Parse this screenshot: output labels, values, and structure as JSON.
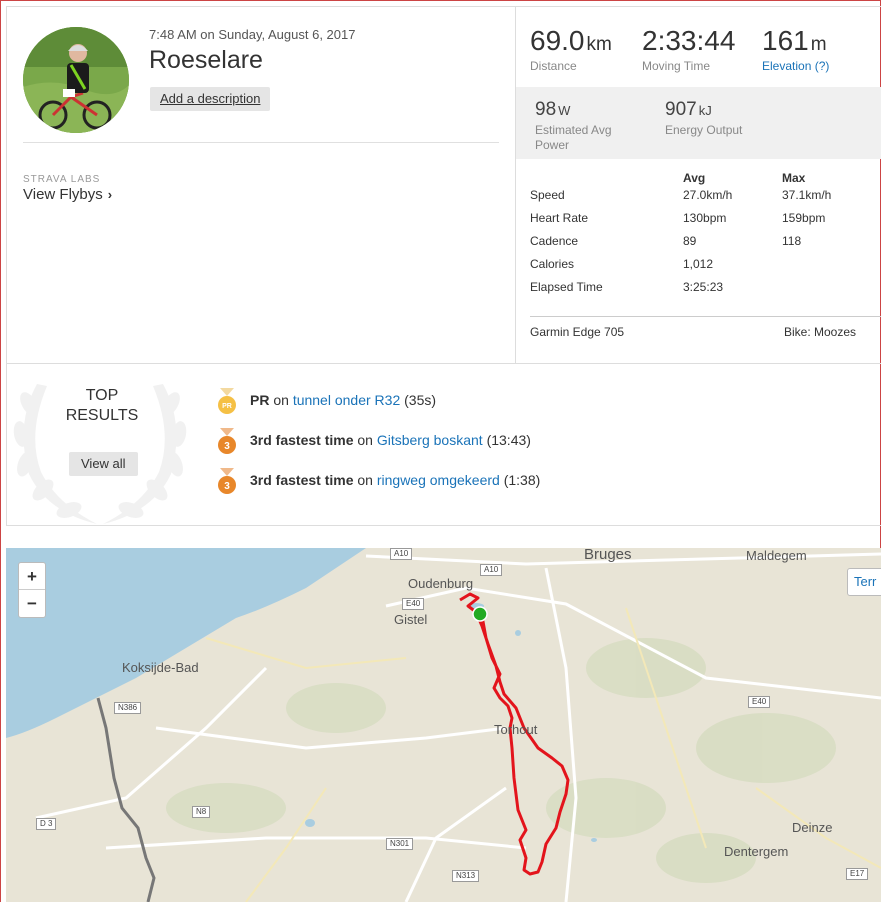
{
  "activity": {
    "timestamp": "7:48 AM on Sunday, August 6, 2017",
    "name": "Roeselare",
    "add_description": "Add a description",
    "labs_label": "STRAVA LABS",
    "flybys_link": "View Flybys",
    "chevron": "›"
  },
  "primary_stats": [
    {
      "value": "69.0",
      "unit": "km",
      "label": "Distance"
    },
    {
      "value": "2:33:44",
      "unit": "",
      "label": "Moving Time"
    },
    {
      "value": "161",
      "unit": "m",
      "label": "Elevation (?)"
    }
  ],
  "secondary_stats": [
    {
      "value": "98",
      "unit": "W",
      "label_line1": "Estimated Avg",
      "label_line2": "Power"
    },
    {
      "value": "907",
      "unit": "kJ",
      "label_line1": "Energy Output",
      "label_line2": ""
    }
  ],
  "more_stats": {
    "headers": {
      "avg": "Avg",
      "max": "Max"
    },
    "rows": [
      {
        "label": "Speed",
        "avg": "27.0km/h",
        "max": "37.1km/h"
      },
      {
        "label": "Heart Rate",
        "avg": "130bpm",
        "max": "159bpm"
      },
      {
        "label": "Cadence",
        "avg": "89",
        "max": "118"
      },
      {
        "label": "Calories",
        "avg": "1,012",
        "max": ""
      },
      {
        "label": "Elapsed Time",
        "avg": "3:25:23",
        "max": ""
      }
    ],
    "device": "Garmin Edge 705",
    "bike": "Bike: Moozes"
  },
  "top_results": {
    "title_line1": "TOP",
    "title_line2": "RESULTS",
    "view_all": "View all",
    "achievements": [
      {
        "medal": "PR",
        "prefix": "PR",
        "on": " on ",
        "segment": "tunnel onder R32",
        "time": " (35s)",
        "medal_color": "#f5c045"
      },
      {
        "medal": "3",
        "prefix": "3rd fastest time",
        "on": " on ",
        "segment": "Gitsberg boskant",
        "time": " (13:43)",
        "medal_color": "#e8872a"
      },
      {
        "medal": "3",
        "prefix": "3rd fastest time",
        "on": " on ",
        "segment": "ringweg omgekeerd",
        "time": " (1:38)",
        "medal_color": "#e8872a"
      }
    ]
  },
  "map": {
    "zoom_in": "+",
    "zoom_out": "−",
    "terrain_button": "Terr",
    "labels": {
      "bruges": "Bruges",
      "maldegem": "Maldegem",
      "oudenburg": "Oudenburg",
      "gistel": "Gistel",
      "koksijde": "Koksijde-Bad",
      "torhout": "Torhout",
      "deinze": "Deinze",
      "dentergem": "Dentergem"
    },
    "roads": {
      "a10a": "A10",
      "a10b": "A10",
      "e40a": "E40",
      "e40b": "E40",
      "n386": "N386",
      "n8": "N8",
      "d3": "D 3",
      "n301": "N301",
      "n313": "N313",
      "e17": "E17"
    },
    "route_color": "#e3141c",
    "sea_color": "#a9cde0"
  }
}
